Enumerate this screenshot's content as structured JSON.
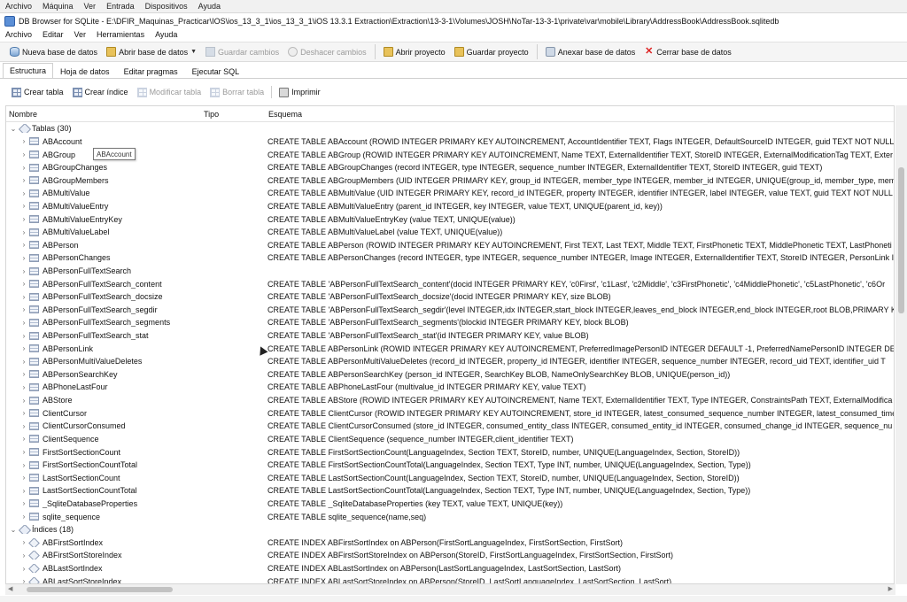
{
  "host_menu": [
    "Archivo",
    "Máquina",
    "Ver",
    "Entrada",
    "Dispositivos",
    "Ayuda"
  ],
  "window": {
    "title": "DB Browser for SQLite - E:\\DFIR_Maquinas_Practicar\\IOS\\ios_13_3_1\\ios_13_3_1\\iOS 13.3.1 Extraction\\Extraction\\13-3-1\\Volumes\\JOSH\\NoTar-13-3-1\\private\\var\\mobile\\Library\\AddressBook\\AddressBook.sqlitedb"
  },
  "menu": [
    "Archivo",
    "Editar",
    "Ver",
    "Herramientas",
    "Ayuda"
  ],
  "toolbar": {
    "new_db": "Nueva base de datos",
    "open_db": "Abrir base de datos",
    "save_changes": "Guardar cambios",
    "undo_changes": "Deshacer cambios",
    "open_project": "Abrir proyecto",
    "save_project": "Guardar proyecto",
    "attach_db": "Anexar base de datos",
    "close_db": "Cerrar base de datos"
  },
  "tabs": [
    "Estructura",
    "Hoja de datos",
    "Editar pragmas",
    "Ejecutar SQL"
  ],
  "subtoolbar": {
    "create_table": "Crear tabla",
    "create_index": "Crear índice",
    "modify_table": "Modificar tabla",
    "delete_table": "Borrar tabla",
    "print": "Imprimir"
  },
  "tree": {
    "headers": {
      "name": "Nombre",
      "type": "Tipo",
      "schema": "Esquema"
    },
    "tables_group": "Tablas (30)",
    "indices_group": "Índices (18)",
    "tables": [
      {
        "name": "ABAccount",
        "schema": "CREATE TABLE ABAccount (ROWID INTEGER PRIMARY KEY AUTOINCREMENT, AccountIdentifier TEXT, Flags INTEGER, DefaultSourceID INTEGER, guid TEXT NOT NULL D"
      },
      {
        "name": "ABGroup",
        "schema": "CREATE TABLE ABGroup (ROWID INTEGER PRIMARY KEY AUTOINCREMENT, Name TEXT, ExternalIdentifier TEXT, StoreID INTEGER, ExternalModificationTag TEXT, Exter"
      },
      {
        "name": "ABGroupChanges",
        "schema": "CREATE TABLE ABGroupChanges (record INTEGER, type INTEGER, sequence_number INTEGER, ExternalIdentifier TEXT, StoreID INTEGER, guid TEXT)"
      },
      {
        "name": "ABGroupMembers",
        "schema": "CREATE TABLE ABGroupMembers (UID INTEGER PRIMARY KEY, group_id INTEGER, member_type INTEGER, member_id INTEGER, UNIQUE(group_id, member_type, mem"
      },
      {
        "name": "ABMultiValue",
        "schema": "CREATE TABLE ABMultiValue (UID INTEGER PRIMARY KEY, record_id INTEGER, property INTEGER, identifier INTEGER, label INTEGER, value TEXT, guid TEXT NOT NULL D"
      },
      {
        "name": "ABMultiValueEntry",
        "schema": "CREATE TABLE ABMultiValueEntry (parent_id INTEGER, key INTEGER, value TEXT, UNIQUE(parent_id, key))"
      },
      {
        "name": "ABMultiValueEntryKey",
        "schema": "CREATE TABLE ABMultiValueEntryKey (value TEXT, UNIQUE(value))"
      },
      {
        "name": "ABMultiValueLabel",
        "schema": "CREATE TABLE ABMultiValueLabel (value TEXT, UNIQUE(value))"
      },
      {
        "name": "ABPerson",
        "schema": "CREATE TABLE ABPerson (ROWID INTEGER PRIMARY KEY AUTOINCREMENT, First TEXT, Last TEXT, Middle TEXT, FirstPhonetic TEXT, MiddlePhonetic TEXT, LastPhoneti"
      },
      {
        "name": "ABPersonChanges",
        "schema": "CREATE TABLE ABPersonChanges (record INTEGER, type INTEGER, sequence_number INTEGER, Image INTEGER, ExternalIdentifier TEXT, StoreID INTEGER, PersonLink I"
      },
      {
        "name": "ABPersonFullTextSearch",
        "schema": ""
      },
      {
        "name": "ABPersonFullTextSearch_content",
        "schema": "CREATE TABLE 'ABPersonFullTextSearch_content'(docid INTEGER PRIMARY KEY, 'c0First', 'c1Last', 'c2Middle', 'c3FirstPhonetic', 'c4MiddlePhonetic', 'c5LastPhonetic', 'c6Or"
      },
      {
        "name": "ABPersonFullTextSearch_docsize",
        "schema": "CREATE TABLE 'ABPersonFullTextSearch_docsize'(docid INTEGER PRIMARY KEY, size BLOB)"
      },
      {
        "name": "ABPersonFullTextSearch_segdir",
        "schema": "CREATE TABLE 'ABPersonFullTextSearch_segdir'(level INTEGER,idx INTEGER,start_block INTEGER,leaves_end_block INTEGER,end_block INTEGER,root BLOB,PRIMARY KEY"
      },
      {
        "name": "ABPersonFullTextSearch_segments",
        "schema": "CREATE TABLE 'ABPersonFullTextSearch_segments'(blockid INTEGER PRIMARY KEY, block BLOB)"
      },
      {
        "name": "ABPersonFullTextSearch_stat",
        "schema": "CREATE TABLE 'ABPersonFullTextSearch_stat'(id INTEGER PRIMARY KEY, value BLOB)"
      },
      {
        "name": "ABPersonLink",
        "schema": "CREATE TABLE ABPersonLink (ROWID INTEGER PRIMARY KEY AUTOINCREMENT, PreferredImagePersonID INTEGER DEFAULT -1, PreferredNamePersonID INTEGER DEFAL"
      },
      {
        "name": "ABPersonMultiValueDeletes",
        "schema": "CREATE TABLE ABPersonMultiValueDeletes (record_id INTEGER, property_id INTEGER, identifier INTEGER, sequence_number INTEGER, record_uid TEXT, identifier_uid T"
      },
      {
        "name": "ABPersonSearchKey",
        "schema": "CREATE TABLE ABPersonSearchKey (person_id INTEGER, SearchKey BLOB, NameOnlySearchKey BLOB, UNIQUE(person_id))"
      },
      {
        "name": "ABPhoneLastFour",
        "schema": "CREATE TABLE ABPhoneLastFour (multivalue_id INTEGER PRIMARY KEY, value TEXT)"
      },
      {
        "name": "ABStore",
        "schema": "CREATE TABLE ABStore (ROWID INTEGER PRIMARY KEY AUTOINCREMENT, Name TEXT, ExternalIdentifier TEXT, Type INTEGER, ConstraintsPath TEXT, ExternalModifica"
      },
      {
        "name": "ClientCursor",
        "schema": "CREATE TABLE ClientCursor (ROWID INTEGER PRIMARY KEY AUTOINCREMENT, store_id INTEGER, latest_consumed_sequence_number INTEGER, latest_consumed_times"
      },
      {
        "name": "ClientCursorConsumed",
        "schema": "CREATE TABLE ClientCursorConsumed (store_id INTEGER, consumed_entity_class INTEGER, consumed_entity_id INTEGER, consumed_change_id INTEGER, sequence_nu"
      },
      {
        "name": "ClientSequence",
        "schema": "CREATE TABLE ClientSequence (sequence_number INTEGER,client_identifier TEXT)"
      },
      {
        "name": "FirstSortSectionCount",
        "schema": "CREATE TABLE FirstSortSectionCount(LanguageIndex, Section TEXT, StoreID, number, UNIQUE(LanguageIndex, Section, StoreID))"
      },
      {
        "name": "FirstSortSectionCountTotal",
        "schema": "CREATE TABLE FirstSortSectionCountTotal(LanguageIndex, Section TEXT, Type INT, number, UNIQUE(LanguageIndex, Section, Type))"
      },
      {
        "name": "LastSortSectionCount",
        "schema": "CREATE TABLE LastSortSectionCount(LanguageIndex, Section TEXT, StoreID, number, UNIQUE(LanguageIndex, Section, StoreID))"
      },
      {
        "name": "LastSortSectionCountTotal",
        "schema": "CREATE TABLE LastSortSectionCountTotal(LanguageIndex, Section TEXT, Type INT, number, UNIQUE(LanguageIndex, Section, Type))"
      },
      {
        "name": "_SqliteDatabaseProperties",
        "schema": "CREATE TABLE _SqliteDatabaseProperties (key TEXT, value TEXT, UNIQUE(key))"
      },
      {
        "name": "sqlite_sequence",
        "schema": "CREATE TABLE sqlite_sequence(name,seq)"
      }
    ],
    "indices": [
      {
        "name": "ABFirstSortIndex",
        "schema": "CREATE INDEX ABFirstSortIndex on ABPerson(FirstSortLanguageIndex, FirstSortSection, FirstSort)"
      },
      {
        "name": "ABFirstSortStoreIndex",
        "schema": "CREATE INDEX ABFirstSortStoreIndex on ABPerson(StoreID, FirstSortLanguageIndex, FirstSortSection, FirstSort)"
      },
      {
        "name": "ABLastSortIndex",
        "schema": "CREATE INDEX ABLastSortIndex on ABPerson(LastSortLanguageIndex, LastSortSection, LastSort)"
      },
      {
        "name": "ABLastSortStoreIndex",
        "schema": "CREATE INDEX ABLastSortStoreIndex on ABPerson(StoreID, LastSortLanguageIndex, LastSortSection, LastSort)"
      }
    ]
  },
  "tooltip": "ABAccount"
}
